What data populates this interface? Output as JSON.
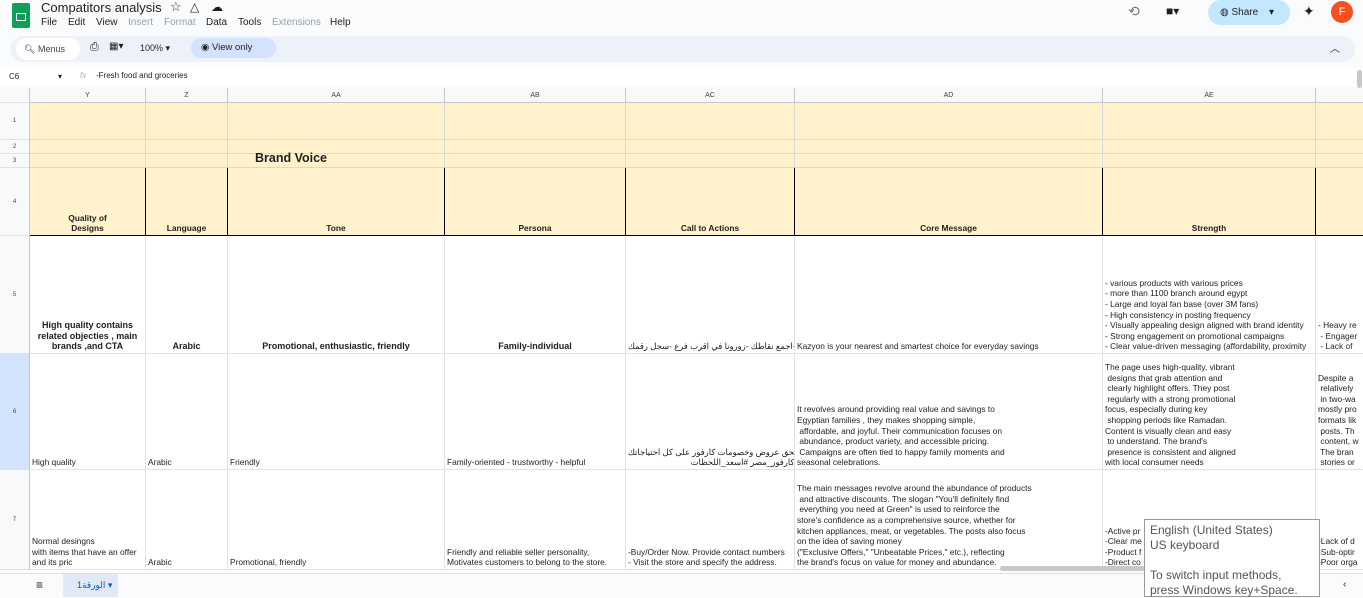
{
  "app": {
    "title": "Compatitors analysis",
    "menus": [
      "File",
      "Edit",
      "View",
      "Insert",
      "Format",
      "Data",
      "Tools",
      "Extensions",
      "Help"
    ],
    "disabled_menus": [
      "Insert",
      "Format",
      "Extensions"
    ],
    "share_label": "Share",
    "avatar_letter": "F"
  },
  "toolbar": {
    "search_label": "Menus",
    "zoom": "100%",
    "view_only": "View only"
  },
  "formula_bar": {
    "cell_ref": "C6",
    "value": "-Fresh food and groceries"
  },
  "columns": [
    "Y",
    "Z",
    "AA",
    "AB",
    "AC",
    "AD",
    "AE",
    ""
  ],
  "rows": [
    "1",
    "2",
    "3",
    "4",
    "5",
    "6",
    "7"
  ],
  "section_title": "Brand Voice",
  "headers": [
    "Quality of\nDesigns",
    "Language",
    "Tone",
    "Persona",
    "Call to Actions",
    "Core Message",
    "Strength",
    ""
  ],
  "row5": [
    "High quality contains\nrelated objecties , main\nbrands ,and CTA",
    "Arabic",
    "Promotional, enthusiastic, friendly",
    "Family-individual",
    "- اشترك -اجمع نقاطك -زورونا في اقرب فرع -سجل رقمك",
    "Kazyon is your nearest and smartest choice for everyday savings",
    "- various products with various prices\n- more than 1100 branch around egypt\n- Large and loyal fan base (over 3M fans)\n- High consistency in posting frequency\n- Visually appealing design aligned with brand identity\n- Strong engagement on promotional campaigns\n- Clear value-driven messaging (affordability, proximity",
    "- Heavy re\n - Engager\n - Lack of"
  ],
  "row6": [
    "High quality",
    "Arabic",
    "Friendly",
    "Family-oriented - trustworthy - helpful",
    "الحق عروض وخصومات كارفور على كل احتياجاتك\n#كارفور_مصر #اسعد_اللحظات",
    "It revolves around providing real value and savings to\nEgyptian families , they makes shopping simple,\n affordable, and joyful. Their communication focuses on\n abundance, product variety, and accessible pricing.\n Campaigns are often tied to happy family moments and\nseasonal celebrations.",
    "The page uses high-quality, vibrant\n designs that grab attention and\n clearly highlight offers. They post\n regularly with a strong promotional\nfocus, especially during key\n shopping periods like Ramadan.\nContent is visually clean and easy\n to understand. The brand's\n presence is consistent and aligned\nwith local consumer needs",
    "Despite a\n relatively\n in two-wa\nmostly pro\nformats lik\n posts. Th\n content, w\n The bran\n stories or"
  ],
  "row7": [
    "Normal desingns\nwith items that have an offer\nand its pric",
    "Arabic",
    "Promotional, friendly",
    "Friendly and reliable seller personality,\nMotivates customers to belong to the store.",
    "-Buy/Order Now. Provide contact numbers\n- Visit the store and specify the address.",
    "The main messages revolve around the abundance of products\n and attractive discounts. The slogan \"You'll definitely find\n everything you need at Green\" is used to reinforce the\nstore's confidence as a comprehensive source, whether for\nkitchen appliances, meat, or vegetables. The posts also focus\non the idea of saving money\n(\"Exclusive Offers,\" \"Unbeatable Prices,\" etc.), reflecting\nthe brand's focus on value for money and abundance.",
    "-Active pr\n-Clear me\n-Product f\n-Direct co",
    "-Lack of d\n-Sub-optir\n-Poor orga"
  ],
  "sheet_tab": "الورقة1",
  "tooltip": {
    "line1": "English (United States)",
    "line2": "US keyboard",
    "line3": "To switch input methods, press Windows key+Space."
  },
  "colors": {
    "cream": "#fff2cc",
    "selection": "#d3e3fd",
    "brand_green": "#0f9d58"
  }
}
